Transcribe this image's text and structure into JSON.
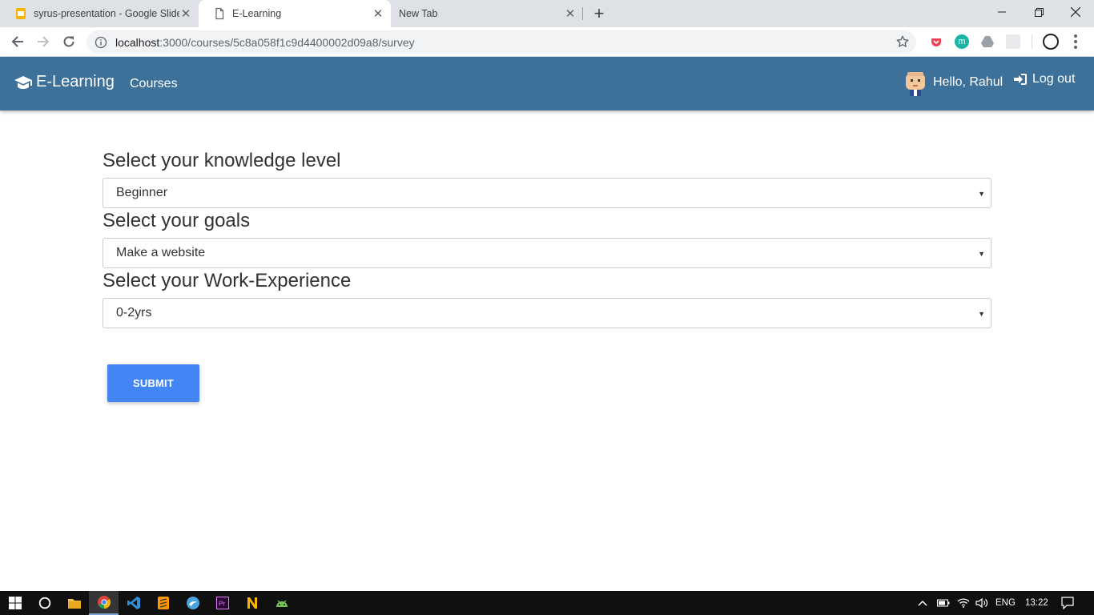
{
  "browser": {
    "tabs": [
      {
        "title": "syrus-presentation - Google Slides",
        "icon": "google-slides-icon",
        "active": false
      },
      {
        "title": "E-Learning",
        "icon": "page-icon",
        "active": true
      },
      {
        "title": "New Tab",
        "icon": "",
        "active": false
      }
    ],
    "url_host": "localhost",
    "url_rest": ":3000/courses/5c8a058f1c9d4400002d09a8/survey"
  },
  "app": {
    "brand": "E-Learning",
    "nav_courses": "Courses",
    "greeting": "Hello, Rahul",
    "logout": "Log out",
    "bar_color": "#3d7199"
  },
  "survey": {
    "questions": [
      {
        "label": "Select your knowledge level",
        "selected": "Beginner"
      },
      {
        "label": "Select your goals",
        "selected": "Make a website"
      },
      {
        "label": "Select your Work-Experience",
        "selected": "0-2yrs"
      }
    ],
    "submit_label": "SUBMIT",
    "submit_color": "#4385f5"
  },
  "taskbar": {
    "language": "ENG",
    "time": "13:22",
    "apps": [
      "windows-start-icon",
      "cortana-icon",
      "file-explorer-icon",
      "chrome-icon",
      "vscode-icon",
      "sublime-icon",
      "browser-icon",
      "premiere-icon",
      "n-app-icon",
      "android-studio-icon"
    ]
  }
}
